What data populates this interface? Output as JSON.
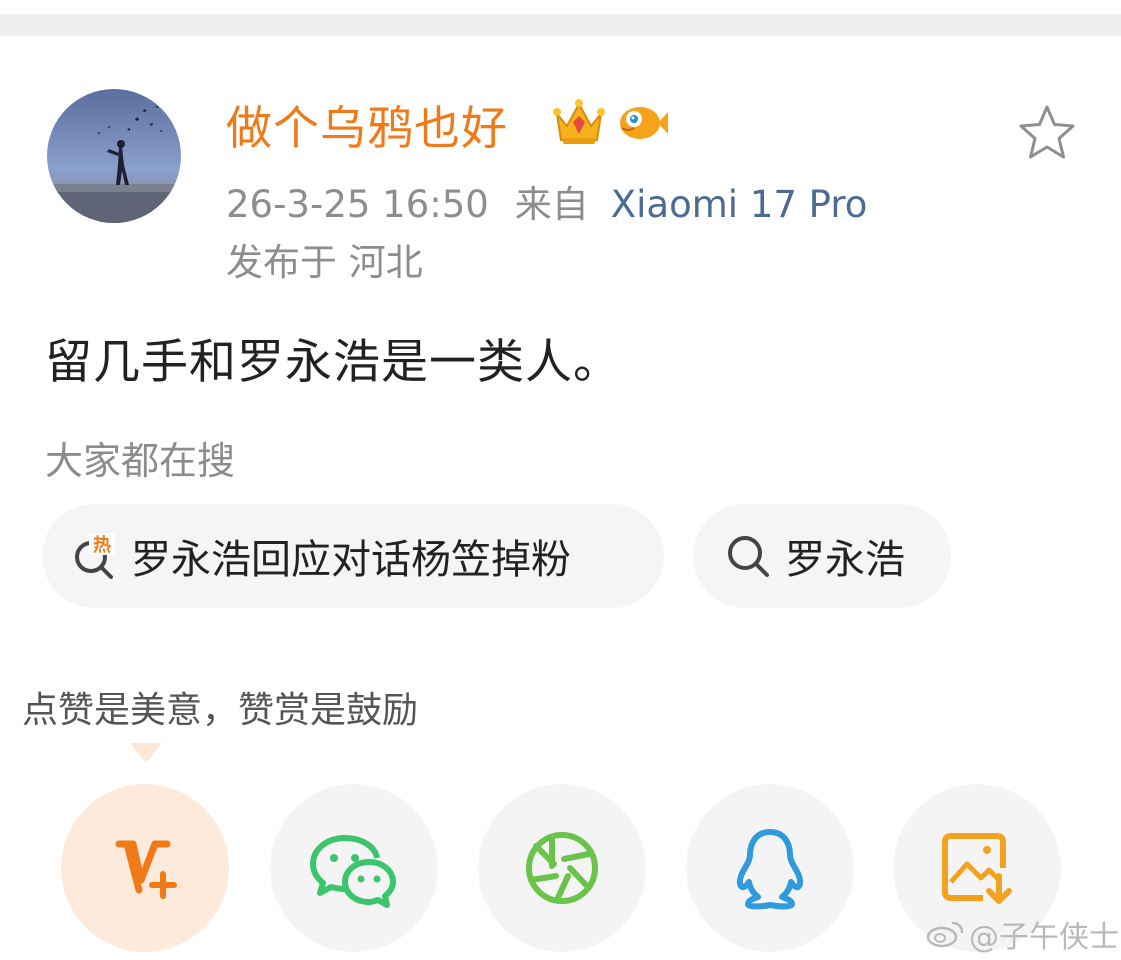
{
  "post": {
    "username": "做个乌鸦也好",
    "badges": [
      "crown-badge-icon",
      "fish-badge-icon"
    ],
    "time": "26-3-25 16:50",
    "from_label": "来自",
    "device": "Xiaomi 17 Pro",
    "location": "发布于 河北",
    "content": "留几手和罗永浩是一类人。"
  },
  "search": {
    "heading": "大家都在搜",
    "chips": [
      {
        "label": "罗永浩回应对话杨笠掉粉",
        "icon": "hot-search-icon"
      },
      {
        "label": "罗永浩",
        "icon": "search-icon"
      }
    ]
  },
  "share": {
    "tip": "点赞是美意，赞赏是鼓励",
    "buttons": [
      {
        "icon": "reward-v-plus-icon",
        "color": "#f07a18"
      },
      {
        "icon": "wechat-icon",
        "color": "#3cc46e"
      },
      {
        "icon": "moments-icon",
        "color": "#6ac34a"
      },
      {
        "icon": "qq-icon",
        "color": "#2f9bdc"
      },
      {
        "icon": "save-image-icon",
        "color": "#f2a21c"
      }
    ]
  },
  "watermark": "@子午侠士",
  "colors": {
    "username": "#f07a18",
    "device": "#4c6a94",
    "meta": "#8d8d8d"
  }
}
